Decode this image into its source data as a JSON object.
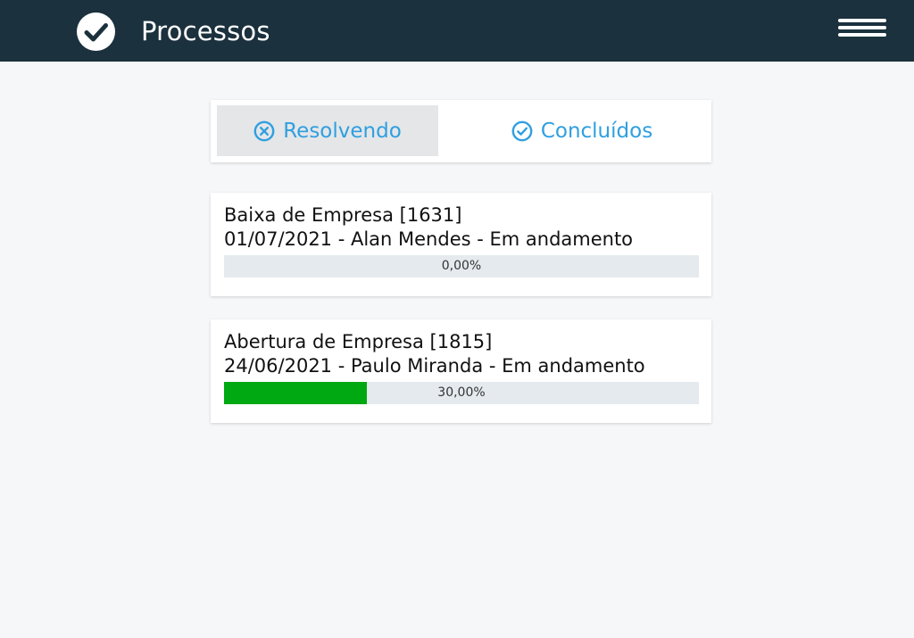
{
  "header": {
    "title": "Processos",
    "logo_icon": "check-circle-icon",
    "menu_icon": "hamburger-menu-icon",
    "background_color": "#1b313d"
  },
  "tabs": [
    {
      "label": "Resolvendo",
      "icon": "close-circle-icon",
      "active": true
    },
    {
      "label": "Concluídos",
      "icon": "check-circle-icon",
      "active": false
    }
  ],
  "accent_color": "#2f9fe0",
  "processes": [
    {
      "title": "Baixa de Empresa [1631]",
      "subtitle": "01/07/2021 - Alan Mendes - Em andamento",
      "progress": 0.0,
      "progress_label": "0,00%",
      "progress_color": "#00a811"
    },
    {
      "title": "Abertura de Empresa [1815]",
      "subtitle": "24/06/2021 - Paulo Miranda - Em andamento",
      "progress": 0.3,
      "progress_label": "30,00%",
      "progress_color": "#00a811"
    }
  ]
}
